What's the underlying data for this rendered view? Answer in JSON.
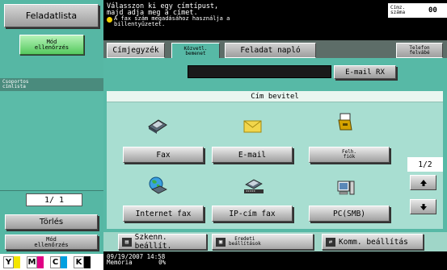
{
  "left_panel": {
    "tasklist_button": "Feladatlista",
    "check_top_button_line1": "Mód",
    "check_top_button_line2": "ellenőrzés",
    "group_list_header_line1": "Csoportos",
    "group_list_header_line2": "címlista",
    "page_counter": "1/  1",
    "delete_button": "Törlés",
    "check_bottom_button_line1": "Mód",
    "check_bottom_button_line2": "ellenőrzés",
    "inks": [
      {
        "letter": "Y",
        "color": "#f3e600"
      },
      {
        "letter": "M",
        "color": "#e00085"
      },
      {
        "letter": "C",
        "color": "#00a0e0"
      },
      {
        "letter": "K",
        "color": "#000000"
      }
    ]
  },
  "message": {
    "line1": "Válasszon ki egy címtípust,",
    "line2": "majd adja meg a címet.",
    "note_line1": "A fax szám megadásához használja a",
    "note_line2": "billentyűzetet."
  },
  "address_count": {
    "label_line1": "Címz.",
    "label_line2": "száma",
    "value": "00"
  },
  "tabs": {
    "addressbook": "Címjegyzék",
    "direct_line1": "Közvetl.",
    "direct_line2": "bemenet",
    "joblog": "Feladat napló",
    "phonebook_line1": "Telefon",
    "phonebook_line2": "felvábé"
  },
  "main": {
    "email_rx_button": "E-mail RX",
    "section_title": "Cím bevitel",
    "page_indicator": "1/2",
    "types": {
      "fax": "Fax",
      "email": "E-mail",
      "user_box_line1": "Felh.",
      "user_box_line2": "fiók",
      "internet_fax": "Internet fax",
      "ip_fax": "IP-cím fax",
      "pc_smb": "PC(SMB)"
    },
    "bottom": {
      "scan_settings": "Szkenn. beállít.",
      "original_settings_line1": "Eredeti",
      "original_settings_line2": "beállítások",
      "comm_settings": "Komm. beállítás"
    }
  },
  "status": {
    "datetime": "09/19/2007   14:58",
    "memory_label": "Memória",
    "memory_value": "0%"
  }
}
